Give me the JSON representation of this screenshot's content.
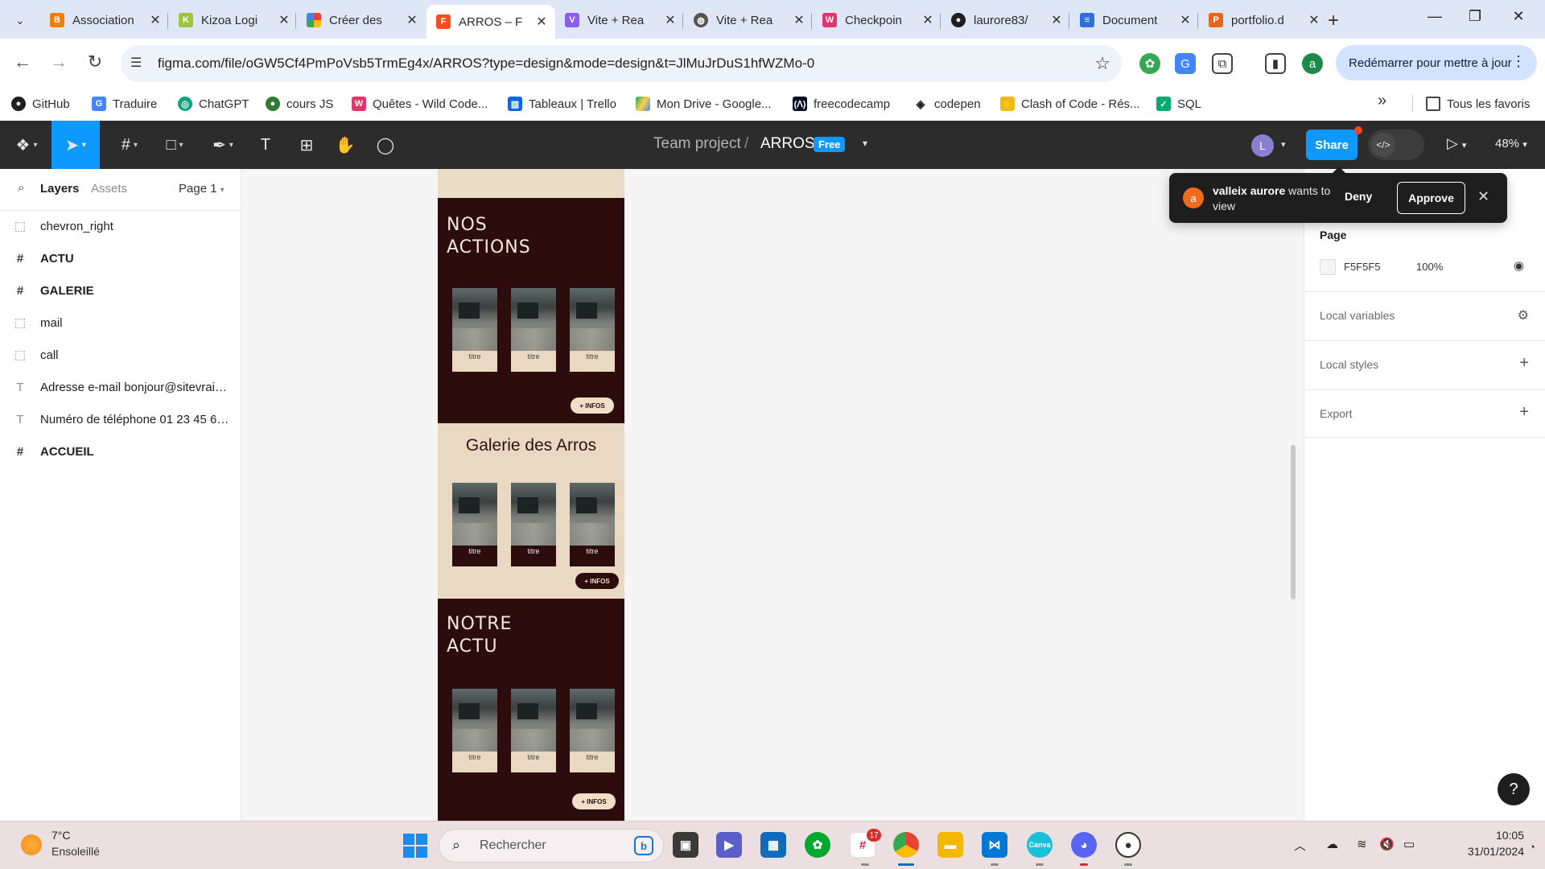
{
  "browser": {
    "tabs": [
      {
        "label": "Association",
        "icon": "blogger-icon",
        "color": "#f57d00"
      },
      {
        "label": "Kizoa Logi",
        "icon": "kizoa-icon",
        "color": "#9bc53d"
      },
      {
        "label": "Créer des",
        "icon": "google-photos-icon",
        "color": "#ea4335"
      },
      {
        "label": "ARROS – F",
        "icon": "figma-icon",
        "color": "#f24e1e",
        "active": true
      },
      {
        "label": "Vite + Rea",
        "icon": "vite-icon",
        "color": "#8b5cf6"
      },
      {
        "label": "Vite + Rea",
        "icon": "globe-icon",
        "color": "#555555"
      },
      {
        "label": "Checkpoin",
        "icon": "wild-code-icon",
        "color": "#e6336b"
      },
      {
        "label": "laurore83/",
        "icon": "github-icon",
        "color": "#1e1e1e"
      },
      {
        "label": "Document",
        "icon": "docs-icon",
        "color": "#2f6fd6"
      },
      {
        "label": "portfolio.d",
        "icon": "portfolio-icon",
        "color": "#e8661a"
      }
    ],
    "tab_close_glyph": "✕",
    "new_tab_glyph": "+",
    "url": "figma.com/file/oGW5Cf4PmPoVsb5TrmEg4x/ARROS?type=design&mode=design&t=JlMuJrDuS1hfWZMo-0",
    "profile_initial": "a",
    "update_button": "Redémarrer pour mettre à jour",
    "bookmarks": [
      {
        "label": "GitHub",
        "icon": "github-icon",
        "color": "#1e1e1e"
      },
      {
        "label": "Traduire",
        "icon": "translate-icon",
        "color": "#4285f4"
      },
      {
        "label": "ChatGPT",
        "icon": "chatgpt-icon",
        "color": "#10a37f"
      },
      {
        "label": "cours JS",
        "icon": "course-icon",
        "color": "#2e7d32"
      },
      {
        "label": "Quêtes - Wild Code...",
        "icon": "wild-code-icon",
        "color": "#e6336b"
      },
      {
        "label": "Tableaux | Trello",
        "icon": "trello-icon",
        "color": "#0c66e4"
      },
      {
        "label": "Mon Drive - Google...",
        "icon": "drive-icon",
        "color": "#1fa463"
      },
      {
        "label": "freecodecamp",
        "icon": "freecodecamp-icon",
        "color": "#0a0a23"
      },
      {
        "label": "codepen",
        "icon": "codepen-icon",
        "color": "#1e1e1e"
      },
      {
        "label": "Clash of Code - Rés...",
        "icon": "codingame-icon",
        "color": "#f2bb13"
      },
      {
        "label": "SQL",
        "icon": "sql-icon",
        "color": "#04aa6d"
      }
    ],
    "all_bookmarks": "Tous les favoris"
  },
  "figma": {
    "project": "Team project",
    "separator": "/",
    "file": "ARROS",
    "plan_badge": "Free",
    "user_avatar": "L",
    "share": "Share",
    "zoom": "48%",
    "left_tabs": {
      "layers": "Layers",
      "assets": "Assets",
      "page": "Page 1"
    },
    "layers": [
      {
        "name": "chevron_right",
        "type": "component",
        "icon": "dotted-frame-icon"
      },
      {
        "name": "ACTU",
        "type": "frame",
        "icon": "frame-icon"
      },
      {
        "name": "GALERIE",
        "type": "frame",
        "icon": "frame-icon"
      },
      {
        "name": "mail",
        "type": "component",
        "icon": "dotted-frame-icon"
      },
      {
        "name": "call",
        "type": "component",
        "icon": "dotted-frame-icon"
      },
      {
        "name": "Adresse e-mail bonjour@sitevraim...",
        "type": "text",
        "icon": "text-icon"
      },
      {
        "name": "Numéro de téléphone 01 23 45 67 ...",
        "type": "text",
        "icon": "text-icon"
      },
      {
        "name": "ACCUEIL",
        "type": "frame",
        "icon": "frame-icon"
      }
    ],
    "artboard": {
      "section1_title": [
        "NOS",
        "ACTIONS"
      ],
      "section2_title": "Galerie des Arros",
      "section3_title": [
        "NOTRE",
        "ACTU"
      ],
      "card_title": "titre",
      "infos_label": "+ INFOS"
    },
    "notification": {
      "avatar": "a",
      "user": "valleix aurore",
      "message": "wants to view",
      "deny": "Deny",
      "approve": "Approve"
    },
    "right_panel": {
      "page_heading": "Page",
      "page_color": "F5F5F5",
      "page_opacity": "100%",
      "rows": [
        "Local variables",
        "Local styles",
        "Export"
      ]
    },
    "help": "?"
  },
  "taskbar": {
    "temperature": "7°C",
    "weather": "Ensoleillé",
    "search_placeholder": "Rechercher",
    "slack_badge": "17",
    "time": "10:05",
    "date": "31/01/2024"
  }
}
